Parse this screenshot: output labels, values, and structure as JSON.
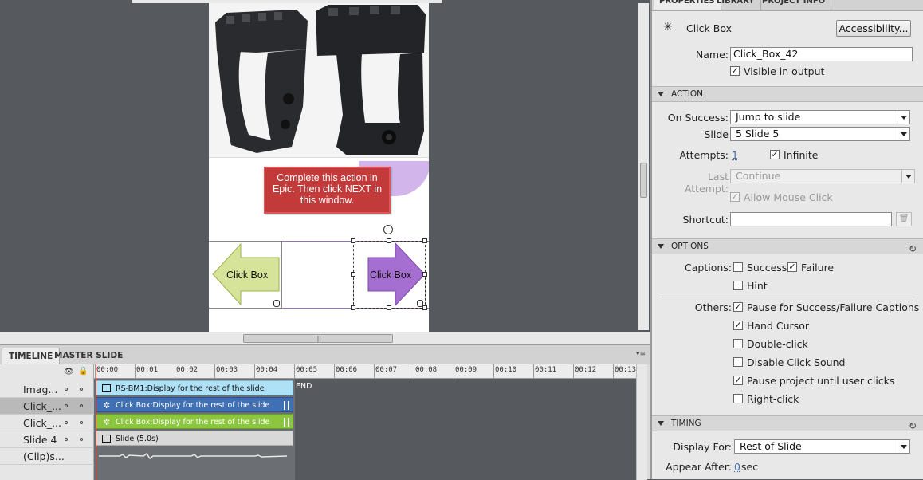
{
  "stage": {
    "caption_text": "Complete this action in Epic.  Then click NEXT in this window.",
    "left_click_box_label": "Click Box",
    "right_click_box_label": "Click Box"
  },
  "timeline": {
    "tabs": [
      "TIMELINE",
      "MASTER SLIDE"
    ],
    "ruler_ticks": [
      "00:00",
      "00:01",
      "00:02",
      "00:03",
      "00:04",
      "00:05",
      "00:06",
      "00:07",
      "00:08",
      "00:09",
      "00:10",
      "00:11",
      "00:12",
      "00:13"
    ],
    "end_label": "END",
    "layers": [
      {
        "name": "Imag...",
        "bar": "RS-BM1:Display for the rest of the slide"
      },
      {
        "name": "Click_...",
        "bar": "Click Box:Display for the rest of the slide"
      },
      {
        "name": "Click_...",
        "bar": "Click Box:Display for the rest of the slide"
      },
      {
        "name": "Slide 4",
        "bar": "Slide (5.0s)"
      },
      {
        "name": "(Clip)s...",
        "bar": ""
      }
    ]
  },
  "properties": {
    "tabs": [
      "PROPERTIES",
      "LIBRARY",
      "PROJECT INFO"
    ],
    "object_type": "Click Box",
    "accessibility_button": "Accessibility...",
    "name_label": "Name:",
    "name_value": "Click_Box_42",
    "visible_label": "Visible in output",
    "action": {
      "header": "ACTION",
      "on_success_label": "On Success:",
      "on_success_value": "Jump to slide",
      "slide_label": "Slide",
      "slide_value": "5 Slide 5",
      "attempts_label": "Attempts:",
      "attempts_value": "1",
      "infinite_label": "Infinite",
      "last_attempt_label": "Last Attempt:",
      "last_attempt_value": "Continue",
      "allow_mouse_click_label": "Allow Mouse Click",
      "shortcut_label": "Shortcut:",
      "shortcut_value": ""
    },
    "options": {
      "header": "OPTIONS",
      "captions_label": "Captions:",
      "success_label": "Success",
      "failure_label": "Failure",
      "hint_label": "Hint",
      "others_label": "Others:",
      "pause_captions_label": "Pause for Success/Failure Captions",
      "hand_cursor_label": "Hand Cursor",
      "double_click_label": "Double-click",
      "disable_click_sound_label": "Disable Click Sound",
      "pause_project_label": "Pause project until user clicks",
      "right_click_label": "Right-click"
    },
    "timing": {
      "header": "TIMING",
      "display_for_label": "Display For:",
      "display_for_value": "Rest of Slide",
      "appear_after_label": "Appear After:",
      "appear_after_value": "0",
      "appear_after_unit": "sec"
    }
  },
  "colors": {
    "caption_bg": "#c23a3a",
    "click_box_bar": "#3f6fb5",
    "click_box_bar_2": "#8cc63f",
    "image_bar": "#aee0f6",
    "left_arrow": "#d6e49a",
    "right_arrow": "#a46fd0"
  }
}
